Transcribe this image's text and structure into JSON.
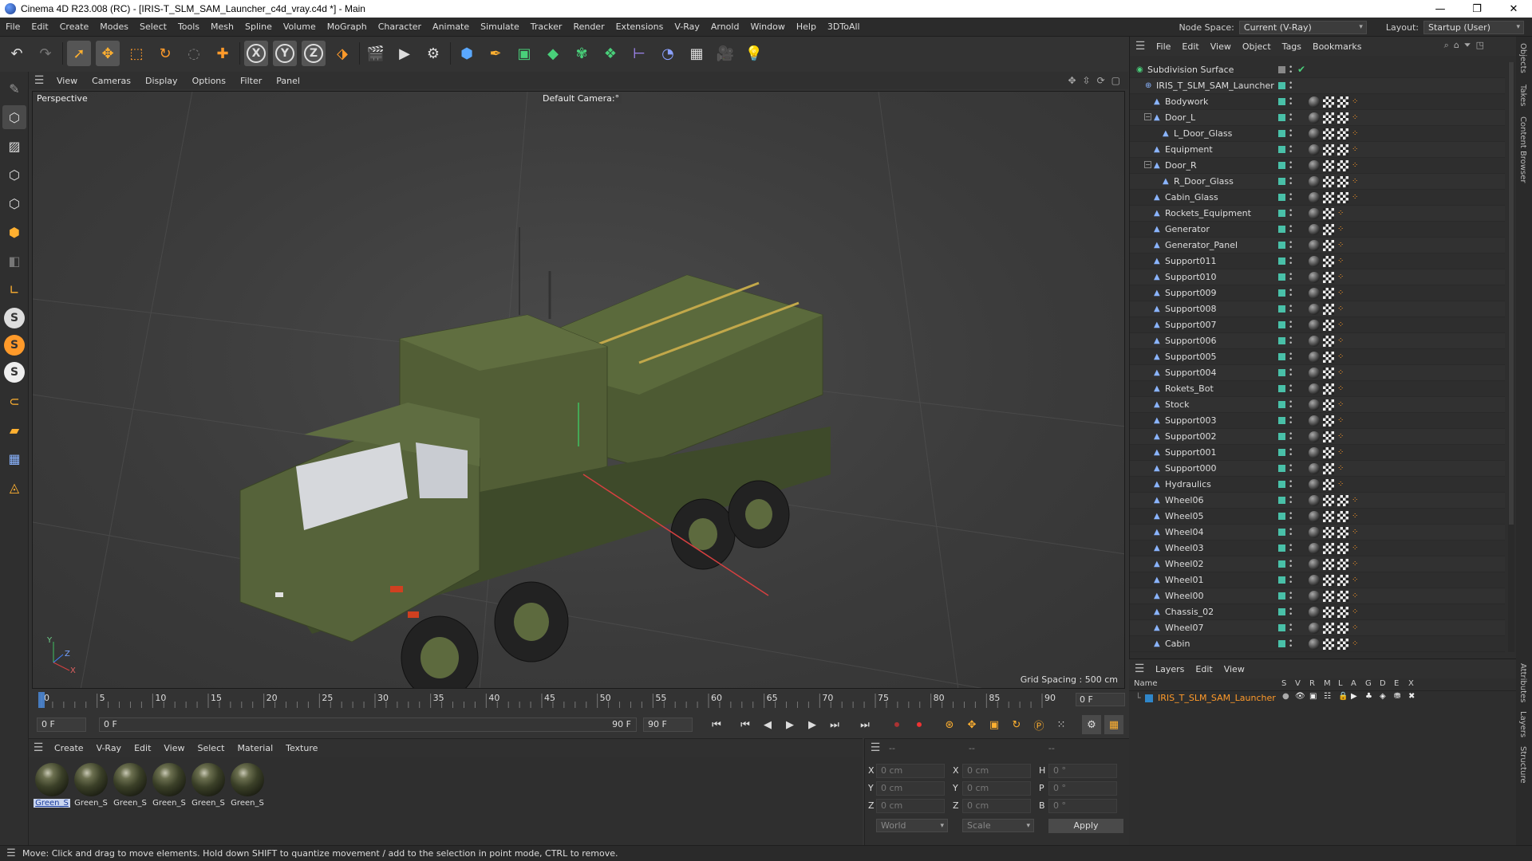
{
  "window": {
    "title": "Cinema 4D R23.008 (RC) - [IRIS-T_SLM_SAM_Launcher_c4d_vray.c4d *] - Main",
    "controls": [
      "—",
      "❐",
      "✕"
    ]
  },
  "menubar": {
    "items": [
      "File",
      "Edit",
      "Create",
      "Modes",
      "Select",
      "Tools",
      "Mesh",
      "Spline",
      "Volume",
      "MoGraph",
      "Character",
      "Animate",
      "Simulate",
      "Tracker",
      "Render",
      "Extensions",
      "V-Ray",
      "Arnold",
      "Window",
      "Help",
      "3DToAll"
    ],
    "node_space_label": "Node Space:",
    "node_space_value": "Current (V-Ray)",
    "layout_label": "Layout:",
    "layout_value": "Startup (User)"
  },
  "toolbar": {
    "icons": [
      "undo-icon",
      "redo-icon",
      "select-icon",
      "move-icon",
      "scale-icon",
      "rotate-icon",
      "live-select-icon",
      "add-icon",
      "x-axis-icon",
      "y-axis-icon",
      "z-axis-icon",
      "coordinate-system-icon",
      "render-region-icon",
      "render-view-icon",
      "render-settings-icon",
      "cube-icon",
      "pen-icon",
      "subdivision-icon",
      "extrude-icon",
      "cloner-icon",
      "mograph-icon",
      "deformer-icon",
      "field-icon",
      "floor-icon",
      "camera-icon",
      "light-icon"
    ],
    "axis_x": "X",
    "axis_y": "Y",
    "axis_z": "Z"
  },
  "viewport": {
    "menu": [
      "View",
      "Cameras",
      "Display",
      "Options",
      "Filter",
      "Panel"
    ],
    "label": "Perspective",
    "camera": "Default Camera",
    "camera_suffix": ":°",
    "grid_spacing": "Grid Spacing : 500 cm",
    "axis_y": "Y",
    "axis_z": "Z",
    "axis_x": "X"
  },
  "timeline": {
    "ticks": [
      0,
      5,
      10,
      15,
      20,
      25,
      30,
      35,
      40,
      45,
      50,
      55,
      60,
      65,
      70,
      75,
      80,
      85,
      90
    ],
    "current": 0,
    "end_field": "0 F"
  },
  "transport": {
    "start_field": "0 F",
    "range_start": "0 F",
    "range_end": "90 F",
    "end_field": "90 F"
  },
  "material_manager": {
    "menu": [
      "Create",
      "V-Ray",
      "Edit",
      "View",
      "Select",
      "Material",
      "Texture"
    ],
    "materials": [
      "Green_S",
      "Green_S",
      "Green_S",
      "Green_S",
      "Green_S",
      "Green_S"
    ]
  },
  "coordinates": {
    "headers": [
      "--",
      "--",
      "--"
    ],
    "rows": [
      {
        "a": "X",
        "v1": "0 cm",
        "b": "X",
        "v2": "0 cm",
        "c": "H",
        "v3": "0 °"
      },
      {
        "a": "Y",
        "v1": "0 cm",
        "b": "Y",
        "v2": "0 cm",
        "c": "P",
        "v3": "0 °"
      },
      {
        "a": "Z",
        "v1": "0 cm",
        "b": "Z",
        "v2": "0 cm",
        "c": "B",
        "v3": "0 °"
      }
    ],
    "mode": "World",
    "scale": "Scale",
    "apply": "Apply"
  },
  "object_manager": {
    "menu": [
      "File",
      "Edit",
      "View",
      "Object",
      "Tags",
      "Bookmarks"
    ],
    "objects": [
      {
        "name": "Subdivision Surface",
        "depth": 0,
        "kind": "subdiv"
      },
      {
        "name": "IRIS_T_SLM_SAM_Launcher",
        "depth": 1,
        "kind": "null"
      },
      {
        "name": "Bodywork",
        "depth": 2,
        "tags": 4
      },
      {
        "name": "Door_L",
        "depth": 2,
        "tags": 4,
        "expand": true
      },
      {
        "name": "L_Door_Glass",
        "depth": 3,
        "tags": 4
      },
      {
        "name": "Equipment",
        "depth": 2,
        "tags": 4
      },
      {
        "name": "Door_R",
        "depth": 2,
        "tags": 4,
        "expand": true
      },
      {
        "name": "R_Door_Glass",
        "depth": 3,
        "tags": 4
      },
      {
        "name": "Cabin_Glass",
        "depth": 2,
        "tags": 4
      },
      {
        "name": "Rockets_Equipment",
        "depth": 2,
        "tags": 3
      },
      {
        "name": "Generator",
        "depth": 2,
        "tags": 3
      },
      {
        "name": "Generator_Panel",
        "depth": 2,
        "tags": 3
      },
      {
        "name": "Support011",
        "depth": 2,
        "tags": 3
      },
      {
        "name": "Support010",
        "depth": 2,
        "tags": 3
      },
      {
        "name": "Support009",
        "depth": 2,
        "tags": 3
      },
      {
        "name": "Support008",
        "depth": 2,
        "tags": 3
      },
      {
        "name": "Support007",
        "depth": 2,
        "tags": 3
      },
      {
        "name": "Support006",
        "depth": 2,
        "tags": 3
      },
      {
        "name": "Support005",
        "depth": 2,
        "tags": 3
      },
      {
        "name": "Support004",
        "depth": 2,
        "tags": 3
      },
      {
        "name": "Rokets_Bot",
        "depth": 2,
        "tags": 3
      },
      {
        "name": "Stock",
        "depth": 2,
        "tags": 3
      },
      {
        "name": "Support003",
        "depth": 2,
        "tags": 3
      },
      {
        "name": "Support002",
        "depth": 2,
        "tags": 3
      },
      {
        "name": "Support001",
        "depth": 2,
        "tags": 3
      },
      {
        "name": "Support000",
        "depth": 2,
        "tags": 3
      },
      {
        "name": "Hydraulics",
        "depth": 2,
        "tags": 3
      },
      {
        "name": "Wheel06",
        "depth": 2,
        "tags": 4
      },
      {
        "name": "Wheel05",
        "depth": 2,
        "tags": 4
      },
      {
        "name": "Wheel04",
        "depth": 2,
        "tags": 4
      },
      {
        "name": "Wheel03",
        "depth": 2,
        "tags": 4
      },
      {
        "name": "Wheel02",
        "depth": 2,
        "tags": 4
      },
      {
        "name": "Wheel01",
        "depth": 2,
        "tags": 4
      },
      {
        "name": "Wheel00",
        "depth": 2,
        "tags": 4
      },
      {
        "name": "Chassis_02",
        "depth": 2,
        "tags": 4
      },
      {
        "name": "Wheel07",
        "depth": 2,
        "tags": 4
      },
      {
        "name": "Cabin",
        "depth": 2,
        "tags": 4
      }
    ]
  },
  "layers": {
    "menu": [
      "Layers",
      "Edit",
      "View"
    ],
    "columns": [
      "Name",
      "S",
      "V",
      "R",
      "M",
      "L",
      "A",
      "G",
      "D",
      "E",
      "X"
    ],
    "layer_name": "IRIS_T_SLM_SAM_Launcher",
    "layer_color": "#ff9a2a"
  },
  "right_tabs": [
    "Objects",
    "Takes",
    "Content Browser",
    "Attributes",
    "Layers",
    "Structure"
  ],
  "status": {
    "message": "Move: Click and drag to move elements. Hold down SHIFT to quantize movement / add to the selection in point mode, CTRL to remove."
  },
  "colors": {
    "accent_orange": "#ff9a2a",
    "layer_green": "#49c0a8",
    "selection_blue": "#1b3c9b"
  }
}
